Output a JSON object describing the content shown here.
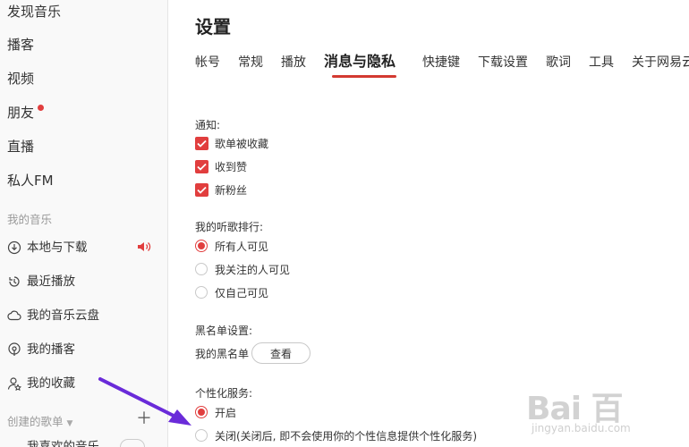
{
  "sidebar": {
    "nav": [
      "发现音乐",
      "播客",
      "视频",
      "朋友",
      "直播",
      "私人FM"
    ],
    "my_music_title": "我的音乐",
    "my_music": [
      "本地与下载",
      "最近播放",
      "我的音乐云盘",
      "我的播客",
      "我的收藏"
    ],
    "created_playlists_title": "创建的歌单",
    "bottom_item": "我喜欢的音乐",
    "icons": [
      "download-icon",
      "history-icon",
      "cloud-icon",
      "podcast-icon",
      "user-star-icon",
      "speaker-icon",
      "plus-icon"
    ]
  },
  "main": {
    "title": "设置",
    "tabs": [
      "帐号",
      "常规",
      "播放",
      "消息与隐私",
      "快捷键",
      "下载设置",
      "歌词",
      "工具",
      "关于网易云"
    ],
    "active_tab": "消息与隐私",
    "notify": {
      "label": "通知:",
      "options": [
        "歌单被收藏",
        "收到赞",
        "新粉丝"
      ],
      "checked": [
        true,
        true,
        true
      ]
    },
    "ranking": {
      "label": "我的听歌排行:",
      "options": [
        "所有人可见",
        "我关注的人可见",
        "仅自己可见"
      ],
      "selected": "所有人可见"
    },
    "blacklist": {
      "label": "黑名单设置:",
      "row_label": "我的黑名单",
      "view_button": "查看"
    },
    "personalize": {
      "label": "个性化服务:",
      "options": [
        "开启",
        "关闭(关闭后, 即不会使用你的个性信息提供个性化服务)"
      ],
      "selected": "开启"
    }
  },
  "watermark": {
    "logo": "Bai 百",
    "url": "jingyan.baidu.com"
  },
  "colors": {
    "accent": "#e13e3e",
    "tab_underline": "#d33a31",
    "sidebar_bg": "#f9f9f9",
    "annotation_arrow": "#6a2bd9"
  }
}
